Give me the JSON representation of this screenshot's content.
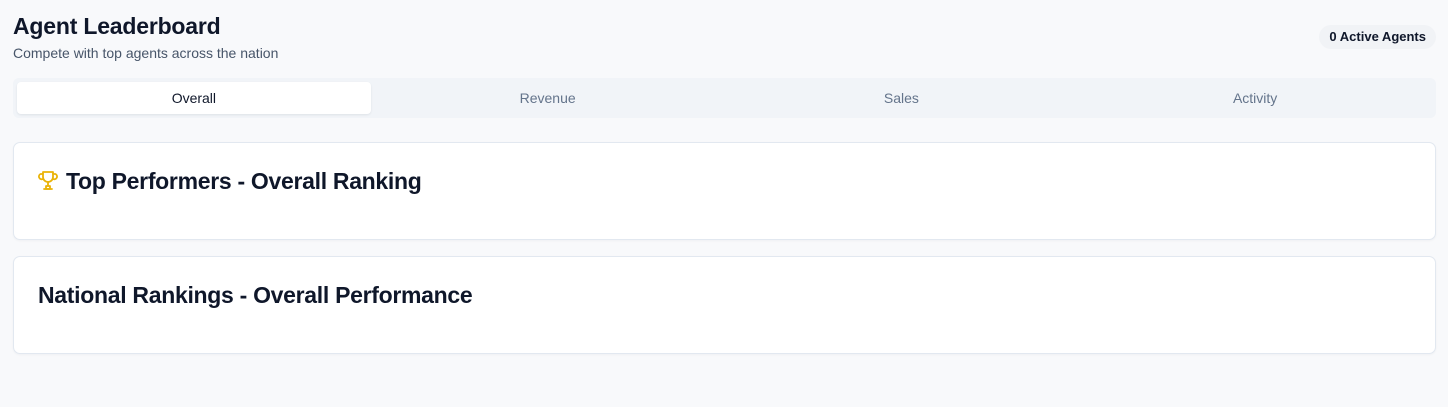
{
  "header": {
    "title": "Agent Leaderboard",
    "subtitle": "Compete with top agents across the nation",
    "active_agents_badge": "0 Active Agents"
  },
  "tabs": [
    {
      "label": "Overall",
      "selected": true
    },
    {
      "label": "Revenue",
      "selected": false
    },
    {
      "label": "Sales",
      "selected": false
    },
    {
      "label": "Activity",
      "selected": false
    }
  ],
  "cards": {
    "top_performers": {
      "icon": "trophy-icon",
      "title": "Top Performers - Overall Ranking"
    },
    "national_rankings": {
      "title": "National Rankings - Overall Performance"
    }
  },
  "colors": {
    "accent_icon": "#eab308",
    "background": "#f8f9fb",
    "tab_bar": "#f1f4f8",
    "text_primary": "#0f172a",
    "text_muted": "#64748b"
  }
}
